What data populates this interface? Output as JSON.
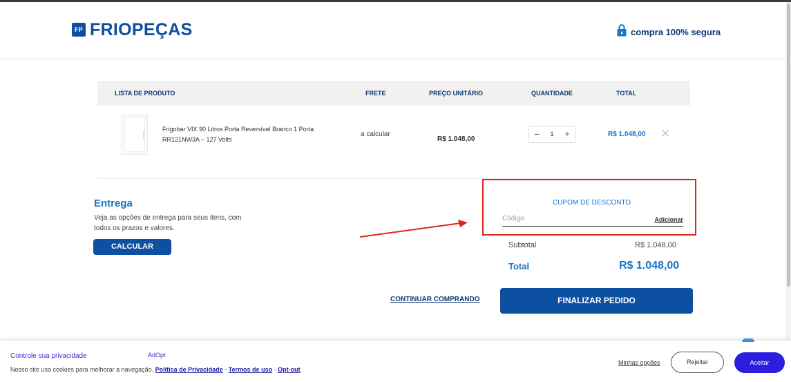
{
  "header": {
    "logo_badge": "FP",
    "logo_text": "FRIOPEÇAS",
    "secure_label": "compra 100% segura"
  },
  "table": {
    "columns": {
      "product_list": "LISTA DE PRODUTO",
      "shipping": "FRETE",
      "unit_price": "PREÇO UNITÁRIO",
      "quantity": "QUANTIDADE",
      "total": "TOTAL"
    },
    "items": [
      {
        "name": "Frigobar VIX 90 Litros Porta Reversível Branco 1 Porta RR121NW3A – 127 Volts",
        "shipping": "a calcular",
        "unit_price": "R$ 1.048,00",
        "quantity": "1",
        "total": "R$ 1.048,00"
      }
    ]
  },
  "delivery": {
    "title": "Entrega",
    "description": "Veja as opções de entrega para seus itens, com todos os prazos e valores.",
    "button": "CALCULAR"
  },
  "coupon": {
    "title": "CUPOM DE DESCONTO",
    "placeholder": "Código",
    "add_label": "Adicionar"
  },
  "summary": {
    "subtotal_label": "Subtotal",
    "subtotal_value": "R$ 1.048,00",
    "total_label": "Total",
    "total_value": "R$ 1.048,00"
  },
  "actions": {
    "continue_label": "CONTINUAR COMPRANDO",
    "finalize_label": "FINALIZAR PEDIDO"
  },
  "cookies": {
    "title": "Controle sua privacidade",
    "brand": "AdOpt",
    "text": "Nosso site usa cookies para melhorar a navegação.",
    "privacy_link": "Política de Privacidade",
    "terms_link": "Termos de uso",
    "optout_link": "Opt-out",
    "separator": "-",
    "options_label": "Minhas opções",
    "reject_label": "Rejeitar",
    "accept_label": "Aceitar"
  },
  "colors": {
    "brand_blue": "#0d4fa0",
    "accent_blue": "#1a73c9",
    "highlight_red": "#e0241b",
    "cookie_accent": "#2a1fdd"
  }
}
